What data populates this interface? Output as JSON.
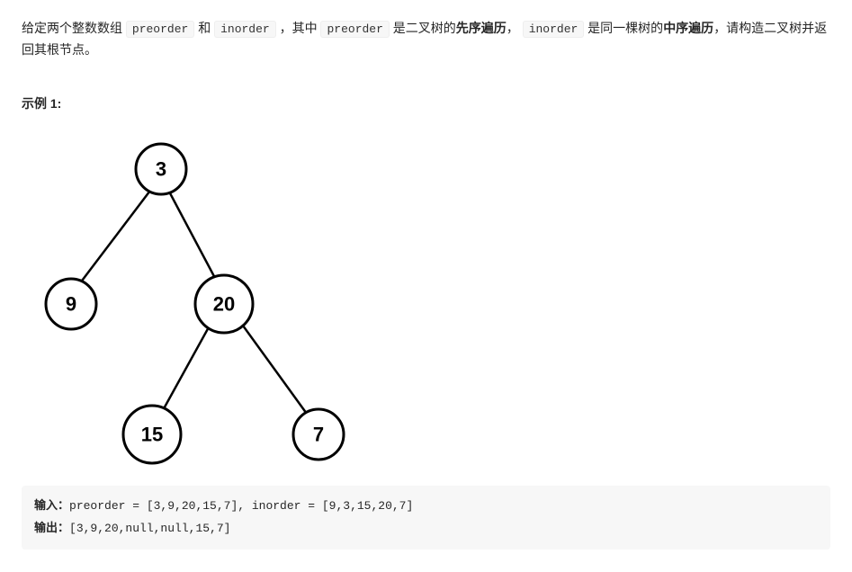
{
  "desc": {
    "t1": "给定两个整数数组 ",
    "c1": "preorder",
    "t2": " 和 ",
    "c2": "inorder",
    "t3": " ，其中 ",
    "c3": "preorder",
    "t4": " 是二叉树的",
    "b1": "先序遍历",
    "t5": "， ",
    "c4": "inorder",
    "t6": " 是同一棵树的",
    "b2": "中序遍历",
    "t7": "，请构造二叉树并返回其根节点。"
  },
  "example_label": "示例 1:",
  "tree": {
    "n1": "3",
    "n2": "9",
    "n3": "20",
    "n4": "15",
    "n5": "7"
  },
  "io": {
    "input_label": "输入：",
    "input_value": "preorder = [3,9,20,15,7], inorder = [9,3,15,20,7]",
    "output_label": "输出：",
    "output_value": "[3,9,20,null,null,15,7]"
  }
}
